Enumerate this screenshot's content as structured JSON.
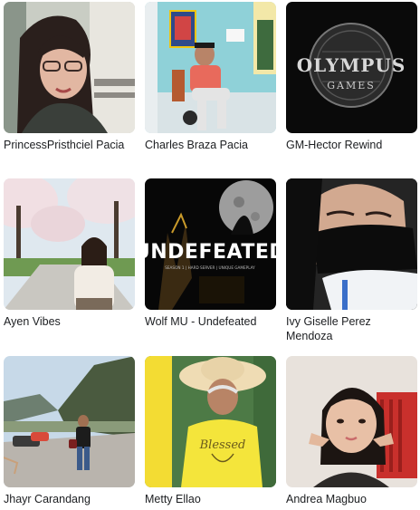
{
  "friends": [
    {
      "name": "PrincessPristhciel Pacia"
    },
    {
      "name": "Charles Braza Pacia"
    },
    {
      "name": "GM-Hector Rewind",
      "logo_text": "OLYMPUS",
      "logo_sub": "GAMES"
    },
    {
      "name": "Ayen Vibes"
    },
    {
      "name": "Wolf MU - Undefeated",
      "logo_text": "UNDEFEATED",
      "logo_sub": "SEASON 1 | HARD SERVER | UNIQUE GAMEPLAY"
    },
    {
      "name": "Ivy Giselle Perez Mendoza"
    },
    {
      "name": "Jhayr Carandang"
    },
    {
      "name": "Metty Ellao",
      "shirt_text": "Blessed"
    },
    {
      "name": "Andrea Magbuo"
    }
  ]
}
